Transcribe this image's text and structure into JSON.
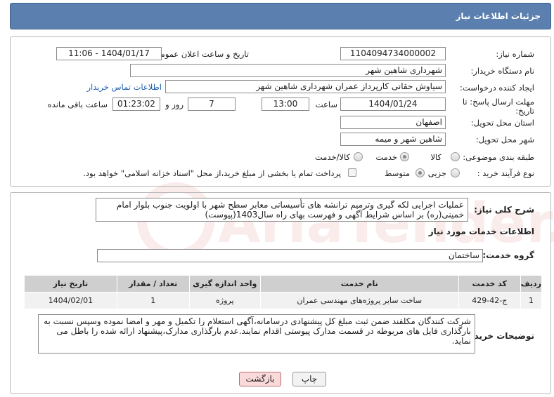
{
  "header": {
    "title": "جزئیات اطلاعات نیاز"
  },
  "fields": {
    "need_number_label": "شماره نیاز:",
    "need_number": "1104094734000002",
    "announce_label": "تاریخ و ساعت اعلان عمومی:",
    "announce_value": "1404/01/17 - 11:06",
    "buyer_org_label": "نام دستگاه خریدار:",
    "buyer_org": "شهرداری شاهین شهر",
    "creator_label": "ایجاد کننده درخواست:",
    "creator": "سیاوش حقانی کارپرداز عمران شهرداری شاهین شهر",
    "contact_link": "اطلاعات تماس خریدار",
    "deadline_label": "مهلت ارسال پاسخ: تا تاریخ:",
    "deadline_date": "1404/01/24",
    "time_label": "ساعت",
    "deadline_time": "13:00",
    "days_value": "7",
    "days_label": "روز و",
    "remaining_time": "01:23:02",
    "remaining_label": "ساعت باقی مانده",
    "province_label": "استان محل تحویل:",
    "province": "اصفهان",
    "city_label": "شهر محل تحویل:",
    "city": "شاهین شهر و میمه",
    "category_label": "طبقه بندی موضوعی:",
    "category_options": [
      "کالا",
      "خدمت",
      "کالا/خدمت"
    ],
    "category_selected": 1,
    "process_label": "نوع فرآیند خرید :",
    "process_options": [
      "جزیی",
      "متوسط"
    ],
    "process_selected": 1,
    "payment_note": "پرداخت تمام یا بخشی از مبلغ خرید،از محل \"اسناد خزانه اسلامی\" خواهد بود."
  },
  "summary": {
    "label": "شرح کلی نیاز:",
    "text": "عملیات اجرایی لکه گیری وترمیم ترانشه های تأسیساتی معابر سطح شهر با اولویت جنوب بلوار امام خمینی(ره) بر اساس شرایط آگهی و فهرست بهای راه سال1403(پیوست)"
  },
  "services": {
    "section_title": "اطلاعات خدمات مورد نیاز",
    "group_label": "گروه خدمت:",
    "group_value": "ساختمان",
    "columns": [
      "ردیف",
      "کد خدمت",
      "نام خدمت",
      "واحد اندازه گیری",
      "تعداد / مقدار",
      "تاریخ نیاز"
    ],
    "rows": [
      [
        "1",
        "ج-42-429",
        "ساخت سایر پروژه‌های مهندسی عمران",
        "پروژه",
        "1",
        "1404/02/01"
      ]
    ]
  },
  "buyer_notes": {
    "label": "توضیحات خریدار:",
    "text": "شرکت کنندگان مکلفند ضمن ثبت مبلغ کل پیشنهادی درسامانه،آگهی استعلام را  تکمیل و مهر و امضا نموده وسپس نسبت به بارگذاری فایل های مربوطه در قسمت مدارک پیوستی اقدام نمایند.عدم بارگذاری مدارک،پیشنهاد ارائه شده را باطل می نماید."
  },
  "buttons": {
    "print": "چاپ",
    "back": "بازگشت"
  },
  "watermark": {
    "text": "AriaTender.net"
  },
  "colors": {
    "header_bg": "#5b7fae",
    "link": "#1f5fb0",
    "back_bg": "#f9d9d9",
    "print_bg": "#f2f2f2"
  }
}
